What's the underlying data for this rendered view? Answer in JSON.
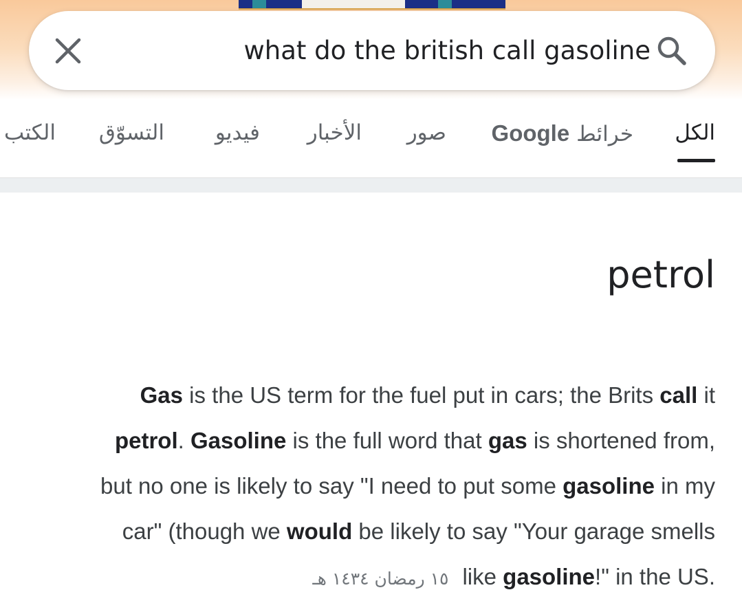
{
  "search": {
    "query": "what do the british call gasoline"
  },
  "tabs": [
    {
      "label": "الكل",
      "active": true
    },
    {
      "label": "خرائط",
      "suffix": "Google",
      "active": false
    },
    {
      "label": "صور",
      "active": false
    },
    {
      "label": "الأخبار",
      "active": false
    },
    {
      "label": "فيديو",
      "active": false
    },
    {
      "label": "التسوّق",
      "active": false
    },
    {
      "label": "الكتب",
      "active": false
    }
  ],
  "result": {
    "answer": "petrol",
    "snippet_lines": [
      [
        [
          "b",
          "Gas"
        ],
        [
          "t",
          " is the US term for the fuel put in cars; the Brits "
        ],
        [
          "b",
          "call"
        ],
        [
          "t",
          " it"
        ]
      ],
      [
        [
          "b",
          "petrol"
        ],
        [
          "t",
          ". "
        ],
        [
          "b",
          "Gasoline"
        ],
        [
          "t",
          " is the full word that "
        ],
        [
          "b",
          "gas"
        ],
        [
          "t",
          " is shortened from,"
        ]
      ],
      [
        [
          "t",
          "but no one is likely to say \"I need to put some "
        ],
        [
          "b",
          "gasoline"
        ],
        [
          "t",
          " in my"
        ]
      ],
      [
        [
          "t",
          "car\" (though we "
        ],
        [
          "b",
          "would"
        ],
        [
          "t",
          " be likely to say \"Your garage smells"
        ]
      ],
      [
        [
          "t",
          "like "
        ],
        [
          "b",
          "gasoline"
        ],
        [
          "t",
          "!\" in the US."
        ]
      ]
    ],
    "date": "١٥ رمضان ١٤٣٤ هـ"
  },
  "colors": {
    "header_gradient_top": "#f9c99b",
    "doodle_blue": "#1b2f86",
    "text_primary": "#202124",
    "text_secondary": "#5f6368",
    "divider": "#eceff1"
  },
  "icons": {
    "clear": "close-icon",
    "search": "search-icon"
  }
}
